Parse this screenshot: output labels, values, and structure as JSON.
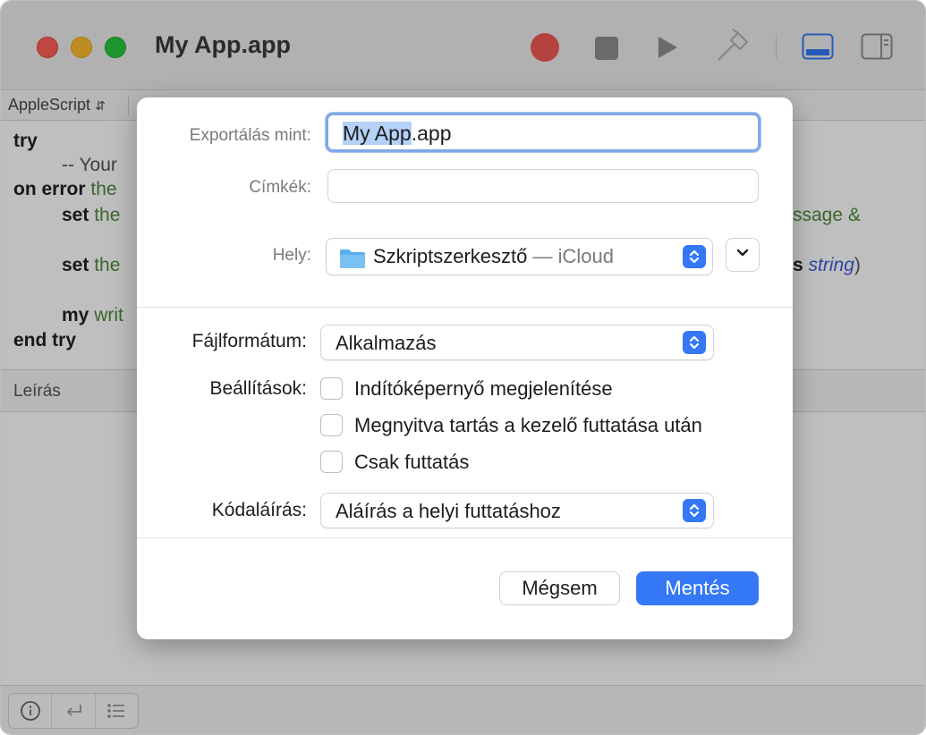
{
  "window": {
    "title": "My App.app"
  },
  "navbar": {
    "language": "AppleScript"
  },
  "editor": {
    "lines": {
      "l1": "try",
      "l2": "-- Your",
      "l3_kw": "on error",
      "l3_var": "the",
      "l4_kw": "set",
      "l4_var": "the",
      "l4_right": "ssage &",
      "l5_kw": "set",
      "l5_var": "the",
      "l5_right_s": "s",
      "l5_right_italic": "string",
      "l5_right_paren": ")",
      "l6_kw": "my",
      "l6_var": "writ",
      "l7": "end try"
    }
  },
  "description": {
    "label": "Leírás"
  },
  "sheet": {
    "export_label": "Exportálás mint:",
    "export_name_selected": "My App",
    "export_name_ext": ".app",
    "tags_label": "Címkék:",
    "tags_value": "",
    "where_label": "Hely:",
    "where_folder": "Szkriptszerkesztő",
    "where_location": " — iCloud",
    "format_label": "Fájlformátum:",
    "format_value": "Alkalmazás",
    "options_label": "Beállítások:",
    "options": [
      {
        "label": "Indítóképernyő megjelenítése",
        "checked": false
      },
      {
        "label": "Megnyitva tartás a kezelő futtatása után",
        "checked": false
      },
      {
        "label": "Csak futtatás",
        "checked": false
      }
    ],
    "signing_label": "Kódaláírás:",
    "signing_value": "Aláírás a helyi futtatáshoz",
    "cancel_label": "Mégsem",
    "save_label": "Mentés"
  },
  "colors": {
    "accent": "#3478f6",
    "close": "#ff5f57",
    "minimize": "#febc2e",
    "maximize": "#28c840",
    "record": "#f15a56"
  },
  "icons": [
    "record-icon",
    "stop-icon",
    "run-icon",
    "compile-hammer-icon",
    "bottom-pane-icon",
    "sidebar-icon",
    "folder-icon",
    "chevron-down-icon",
    "up-down-stepper-icon",
    "info-icon",
    "return-icon",
    "list-icon"
  ]
}
